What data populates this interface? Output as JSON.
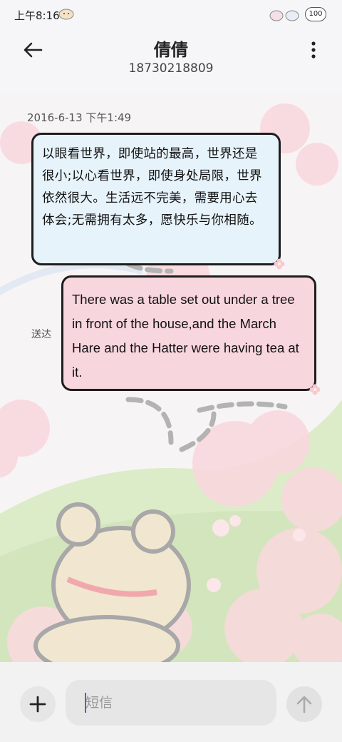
{
  "status_bar": {
    "time": "上午8:16",
    "battery": "100"
  },
  "header": {
    "contact_name": "倩倩",
    "contact_number": "18730218809"
  },
  "conversation": {
    "timestamp": "2016-6-13 下午1:49",
    "messages": [
      {
        "direction": "received",
        "text": "以眼看世界，即使站的最高，世界还是很小;以心看世界，即使身处局限，世界依然很大。生活远不完美，需要用心去体会;无需拥有太多，愿快乐与你相随。"
      },
      {
        "direction": "sent",
        "text": "There was a table set out under a tree in front of the house,and the March Hare and the Hatter were having tea at it.",
        "status": "送达"
      }
    ]
  },
  "composer": {
    "placeholder": "短信"
  },
  "colors": {
    "received_bubble": "#e7f3fb",
    "sent_bubble": "#f8d6de",
    "bubble_border": "#1d1d1d",
    "caret": "#2f6fd6"
  },
  "icons": {
    "back": "arrow-left-icon",
    "more": "more-vertical-icon",
    "add": "plus-icon",
    "send": "arrow-up-icon"
  }
}
